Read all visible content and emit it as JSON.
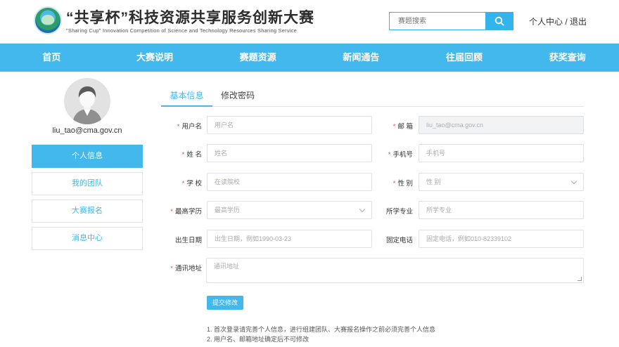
{
  "header": {
    "title": "“共享杯”科技资源共享服务创新大赛",
    "subtitle": "\"Sharing Cup\"  Innovation Competition of Science and Technology Resources Sharing Service",
    "search_placeholder": "赛题搜索",
    "user_center": "个人中心",
    "separator": " / ",
    "logout": "退出"
  },
  "nav": [
    "首页",
    "大赛说明",
    "赛题资源",
    "新闻通告",
    "往届回顾",
    "获奖查询"
  ],
  "sidebar": {
    "email": "liu_tao@cma.gov.cn",
    "items": [
      "个人信息",
      "我的团队",
      "大赛报名",
      "消息中心"
    ],
    "active_index": 0
  },
  "tabs": [
    "基本信息",
    "修改密码"
  ],
  "form": {
    "username_label": "用户名",
    "username_placeholder": "用户名",
    "email_label": "邮 箱",
    "email_value": "liu_tao@cma.gov.cn",
    "name_label": "姓 名",
    "name_placeholder": "姓名",
    "phone_label": "手机号",
    "phone_placeholder": "手机号",
    "school_label": "学 校",
    "school_placeholder": "在读院校",
    "gender_label": "性 别",
    "gender_placeholder": "性 别",
    "degree_label": "最高学历",
    "degree_placeholder": "最高学历",
    "major_label": "所学专业",
    "major_placeholder": "所学专业",
    "birth_label": "出生日期",
    "birth_placeholder": "出生日期，例如1990-03-23",
    "tel_label": "固定电话",
    "tel_placeholder": "固定电话，例如010-82339102",
    "address_label": "通讯地址",
    "address_placeholder": "通讯地址",
    "submit_label": "提交修改"
  },
  "notes": [
    "1. 首次登录请完善个人信息，进行组建团队、大赛报名操作之前必须完善个人信息",
    "2. 用户名、邮箱地址确定后不可修改"
  ],
  "colors": {
    "accent": "#42b8ec",
    "required": "#e84d4d"
  }
}
